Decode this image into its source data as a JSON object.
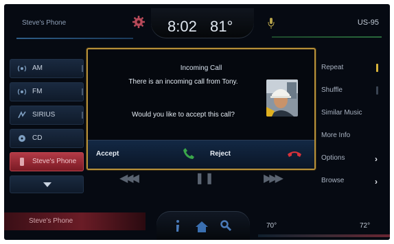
{
  "status_bar": {
    "phone_name": "Steve's Phone",
    "time": "8:02",
    "temperature": "81°",
    "route": "US-95"
  },
  "sources": [
    {
      "label": "AM",
      "icon": "am-radio-icon",
      "active": false
    },
    {
      "label": "FM",
      "icon": "fm-radio-icon",
      "active": false
    },
    {
      "label": "SIRIUS",
      "icon": "sirius-icon",
      "active": false
    },
    {
      "label": "CD",
      "icon": "cd-icon",
      "active": false
    },
    {
      "label": "Steve's Phone",
      "icon": "phone-device-icon",
      "active": true
    }
  ],
  "menu": [
    {
      "label": "Repeat",
      "indicator": "on"
    },
    {
      "label": "Shuffle",
      "indicator": "off"
    },
    {
      "label": "Similar Music",
      "indicator": "none"
    },
    {
      "label": "More Info",
      "indicator": "none"
    },
    {
      "label": "Options",
      "indicator": "chevron"
    },
    {
      "label": "Browse",
      "indicator": "chevron"
    }
  ],
  "dialog": {
    "title": "Incoming Call",
    "message_line1": "There is an incoming call from Tony.",
    "message_line2": "Would you like to accept this call?",
    "accept_label": "Accept",
    "reject_label": "Reject"
  },
  "bottom_bar": {
    "phone_name": "Steve's Phone",
    "temp_left": "70°",
    "temp_right": "72°"
  },
  "colors": {
    "dialog_border": "#b8913a",
    "accept_green": "#3aa64a",
    "reject_red": "#d8323a",
    "active_source_red": "#b33a46"
  }
}
